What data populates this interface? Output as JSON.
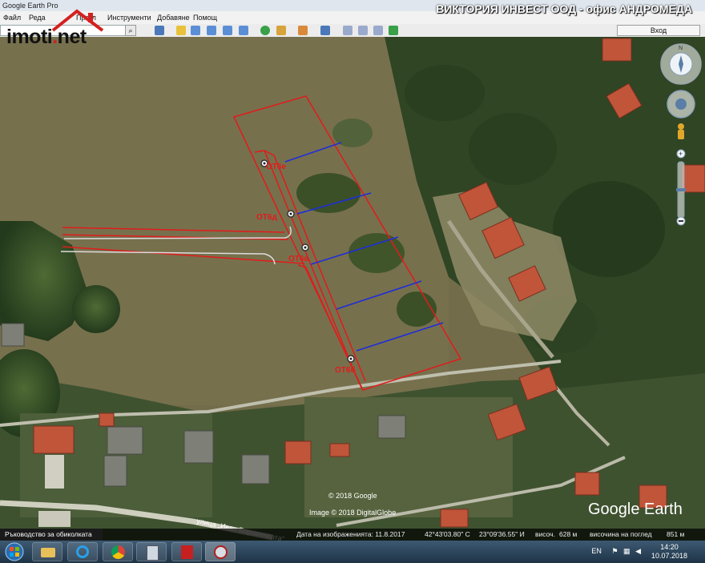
{
  "window": {
    "title": "Google Earth Pro"
  },
  "banner": {
    "text": "ВИКТОРИЯ ИНВЕСТ ООД - офис АНДРОМЕДА"
  },
  "logo": {
    "text_main": "imoti",
    "text_dot": ".",
    "text_tld": "net"
  },
  "menu": {
    "items": [
      "Файл",
      "Реда",
      "Прегл",
      "Инструменти",
      "Добавяне",
      "Помощ"
    ]
  },
  "toolbar": {
    "login_label": "Вход"
  },
  "map": {
    "lot_labels": [
      "ОТ6е",
      "ОТ6д",
      "ОТ6в",
      "ОТ6б"
    ],
    "street_label": "улица „Иван Боримечката“",
    "copyright_google": "© 2018 Google",
    "copyright_imagery": "Image © 2018 DigitalGlobe",
    "watermark": "Google Earth"
  },
  "status": {
    "sidebar_tab": "Ръководство за обиколката",
    "imagery_date": "Дата на изображенията: 11.8.2017",
    "latitude": "42°43'03.80\" С",
    "longitude": "23°09'36.55\" И",
    "elevation_label": "височ.",
    "elevation_value": "628 м",
    "eye_alt_label": "височина на поглед",
    "eye_alt_value": "851 м"
  },
  "taskbar": {
    "language": "EN",
    "time": "14:20",
    "date": "10.07.2018"
  },
  "colors": {
    "boundary": "#e21b1b",
    "division": "#1e2ed8",
    "status_text": "#eeeeee"
  },
  "icons": [
    "windows-start-icon",
    "folder-icon",
    "ie-icon",
    "chrome-icon",
    "calculator-icon",
    "pdf-icon",
    "google-earth-icon",
    "search-icon",
    "compass-icon",
    "person-icon",
    "zoom-in-icon",
    "zoom-out-icon"
  ]
}
